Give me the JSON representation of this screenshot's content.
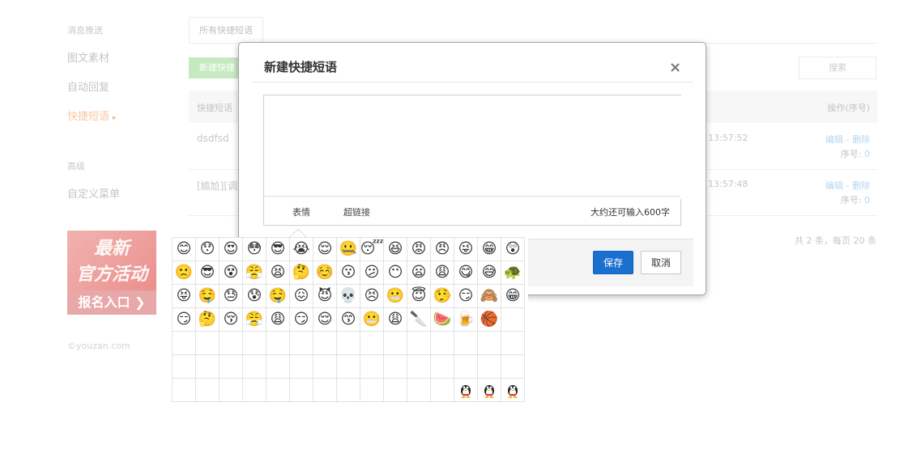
{
  "sidebar": {
    "group1": "消息推送",
    "items1": [
      "图文素材",
      "自动回复",
      "快捷短语"
    ],
    "active_arrow": "▸",
    "group2": "高级",
    "items2": [
      "自定义菜单"
    ],
    "promo": {
      "line1": "最新",
      "line2": "官方活动",
      "line3": "报名入口 ❯"
    },
    "copyright": "©youzan.com"
  },
  "main": {
    "tab": "所有快捷短语",
    "new_button": "新建快捷",
    "search_placeholder": "搜索",
    "table": {
      "col_phrase": "快捷短语",
      "col_ops": "操作(序号)",
      "rows": [
        {
          "text": "dsdfsd",
          "time": "13:57:52",
          "ops": "编辑 - 删除",
          "index_label": "序号: ",
          "index": "0"
        },
        {
          "text": "[尴尬][调皮",
          "time": "13:57:48",
          "ops": "编辑 - 删除",
          "index_label": "序号: ",
          "index": "0"
        }
      ]
    },
    "pager": "共 2 条，每页 20 条"
  },
  "modal": {
    "title": "新建快捷短语",
    "close_label": "×",
    "toolbar": {
      "emoji": "表情",
      "link": "超链接",
      "counter": "大约还可输入600字"
    },
    "save_label": "保存",
    "cancel_label": "取消"
  },
  "emoji_panel": {
    "faces": [
      "😊",
      "😯",
      "😍",
      "😳",
      "😎",
      "😭",
      "😌",
      "🤐",
      "😴",
      "😆",
      "😡",
      "😠",
      "😜",
      "😁",
      "😲",
      "🙁",
      "😎",
      "😵",
      "😤",
      "😫",
      "🤔",
      "☺️",
      "😗",
      "😕",
      "😶",
      "😦",
      "😩",
      "😋",
      "😅",
      "🐢",
      "😝",
      "🤤",
      "😓",
      "😰",
      "🤤",
      "😖",
      "😈",
      "💀",
      "😣",
      "😬",
      "😇",
      "🤥",
      "😏",
      "🙈",
      "😁",
      "😏",
      "🤔",
      "😚",
      "😤",
      "😩",
      "😏",
      "😌",
      "😙",
      "😬",
      "😩",
      "🔪",
      "🍉",
      "🍺",
      "🏀"
    ],
    "qq_count": 3,
    "qq_icon": "qq-penguin-icon"
  }
}
